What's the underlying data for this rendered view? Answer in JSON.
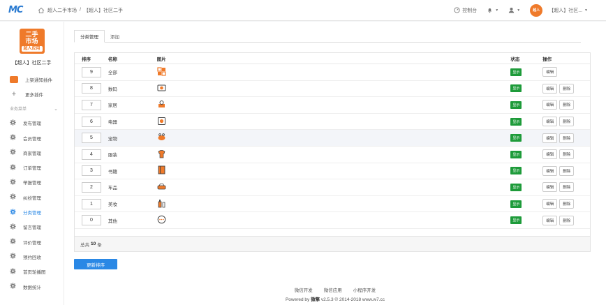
{
  "header": {
    "logo_text": "MC",
    "breadcrumb": [
      "超人二手市场",
      "/",
      "【超人】社区二手"
    ],
    "console_label": "控制台",
    "account_label": "【超人】社区...",
    "avatar_text": "超人"
  },
  "sidebar": {
    "app_logo_line1": "二手",
    "app_logo_line2": "市场",
    "app_logo_sub": "超人应用",
    "app_name": "【超人】社区二手",
    "plugin_item": "上架通知插件",
    "more_plugins": "更多插件",
    "section_title": "业务菜单",
    "items": [
      "发布管理",
      "会员管理",
      "商家管理",
      "订单管理",
      "举报管理",
      "纠纷管理",
      "分类管理",
      "留言管理",
      "评价管理",
      "预约回收",
      "首页轮播图",
      "数据统计"
    ],
    "active_index": 6
  },
  "tabs": [
    "分类管理",
    "添加"
  ],
  "table": {
    "headers": [
      "排序",
      "名称",
      "图片",
      "状态",
      "操作"
    ],
    "rows": [
      {
        "sort": "9",
        "name": "全部",
        "status": "显示",
        "ops": [
          "编辑"
        ]
      },
      {
        "sort": "8",
        "name": "数码",
        "status": "显示",
        "ops": [
          "编辑",
          "删除"
        ]
      },
      {
        "sort": "7",
        "name": "家居",
        "status": "显示",
        "ops": [
          "编辑",
          "删除"
        ]
      },
      {
        "sort": "6",
        "name": "电器",
        "status": "显示",
        "ops": [
          "编辑",
          "删除"
        ]
      },
      {
        "sort": "5",
        "name": "宠物",
        "status": "显示",
        "ops": [
          "编辑",
          "删除"
        ]
      },
      {
        "sort": "4",
        "name": "服装",
        "status": "显示",
        "ops": [
          "编辑",
          "删除"
        ]
      },
      {
        "sort": "3",
        "name": "书籍",
        "status": "显示",
        "ops": [
          "编辑",
          "删除"
        ]
      },
      {
        "sort": "2",
        "name": "车品",
        "status": "显示",
        "ops": [
          "编辑",
          "删除"
        ]
      },
      {
        "sort": "1",
        "name": "美妆",
        "status": "显示",
        "ops": [
          "编辑",
          "删除"
        ]
      },
      {
        "sort": "0",
        "name": "其他",
        "status": "显示",
        "ops": [
          "编辑",
          "删除"
        ]
      }
    ],
    "total_prefix": "总共",
    "total_count": "10",
    "total_suffix": "条"
  },
  "update_button": "更新排序",
  "footer": {
    "links": [
      "微信开发",
      "微信应用",
      "小程序开发"
    ],
    "copy_prefix": "Powered by",
    "brand": "微擎",
    "copy_suffix": "v2.5.3 © 2014-2018 www.w7.cc"
  },
  "colors": {
    "accent": "#2a88e5",
    "brand_orange": "#ef7a2a",
    "status_green": "#1e9b3a"
  }
}
